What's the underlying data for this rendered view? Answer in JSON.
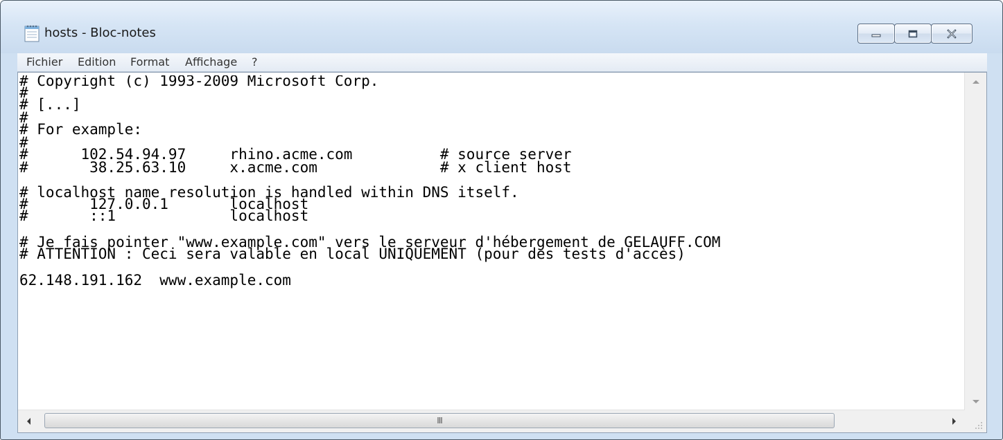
{
  "window": {
    "title": "hosts - Bloc-notes",
    "app_icon": "notepad-icon",
    "controls": [
      "minimize-icon",
      "maximize-icon",
      "close-icon"
    ]
  },
  "menu": {
    "items": [
      "Fichier",
      "Edition",
      "Format",
      "Affichage",
      "?"
    ]
  },
  "document": {
    "lines": [
      "# Copyright (c) 1993-2009 Microsoft Corp.",
      "#",
      "# [...]",
      "#",
      "# For example:",
      "#",
      "#      102.54.94.97     rhino.acme.com          # source server",
      "#       38.25.63.10     x.acme.com              # x client host",
      "",
      "# localhost name resolution is handled within DNS itself.",
      "#       127.0.0.1       localhost",
      "#       ::1             localhost",
      "",
      "# Je fais pointer \"www.example.com\" vers le serveur d'hébergement de GELAUFF.COM",
      "# ATTENTION : Ceci sera valable en local UNIQUEMENT (pour des tests d'accès)",
      "",
      "62.148.191.162  www.example.com"
    ]
  },
  "scrollbars": {
    "vertical": [
      "scroll-up-arrow-icon",
      "scroll-down-arrow-icon"
    ],
    "horizontal": [
      "scroll-left-arrow-icon",
      "scroll-right-arrow-icon"
    ],
    "grip_icon": "size-grip-icon"
  },
  "colors": {
    "frame": "#cfe0f2",
    "menubar": "#e9eff6",
    "text": "#000000"
  }
}
